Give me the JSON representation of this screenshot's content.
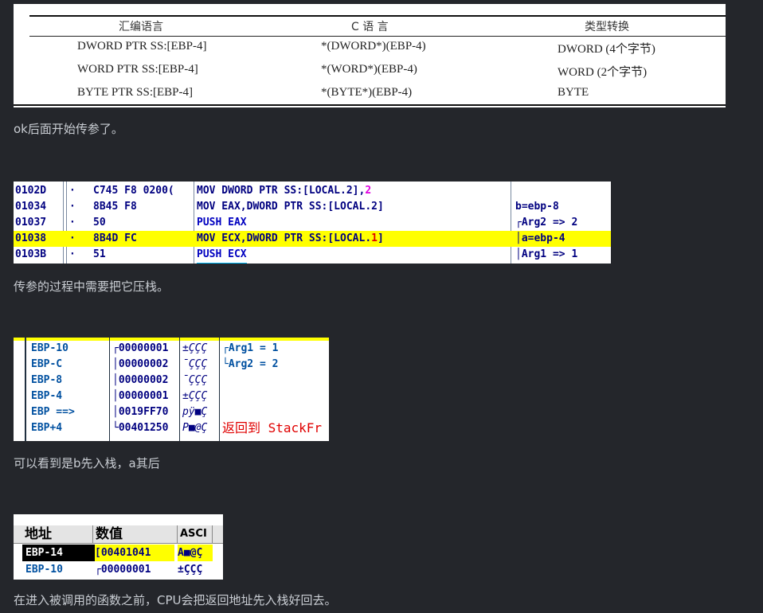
{
  "table": {
    "headers": [
      "汇编语言",
      "C 语 言",
      "类型转换"
    ],
    "rows": [
      [
        "DWORD PTR SS:[EBP-4]",
        "*(DWORD*)(EBP-4)",
        "DWORD (4个字节)"
      ],
      [
        "WORD PTR SS:[EBP-4]",
        "*(WORD*)(EBP-4)",
        "WORD (2个字节)"
      ],
      [
        "BYTE PTR SS:[EBP-4]",
        "*(BYTE*)(EBP-4)",
        "BYTE"
      ]
    ]
  },
  "paragraphs": [
    "ok后面开始传参了。",
    "传参的过程中需要把它压栈。",
    "可以看到是b先入栈，a其后",
    "在进入被调用的函数之前，CPU会把返回地址先入栈好回去。"
  ],
  "code": {
    "rows": [
      {
        "addr": "0102D",
        "dot": "·",
        "hex": "C745 F8 0200(",
        "asm_a": "MOV DWORD PTR SS:[LOCAL.2],",
        "asm_b": "2",
        "comment": ""
      },
      {
        "addr": "01034",
        "dot": "·",
        "hex": "8B45 F8",
        "asm_a": "MOV EAX,DWORD PTR SS:[LOCAL.2]",
        "asm_b": "",
        "comment": "b=ebp-8"
      },
      {
        "addr": "01037",
        "dot": "·",
        "hex": "50",
        "asm_a": "PUSH EAX",
        "asm_b": "",
        "comment": "┌Arg2 => 2"
      },
      {
        "addr": "01038",
        "dot": "·",
        "hex": "8B4D FC",
        "asm_a": "MOV ECX,DWORD PTR SS:[LOCAL.",
        "asm_b": "1",
        "asm_c": "]",
        "comment": "│a=ebp-4"
      },
      {
        "addr": "0103B",
        "dot": "·",
        "hex": "51",
        "asm_a": "PUSH ECX",
        "asm_b": "",
        "comment": "│Arg1 => 1"
      }
    ]
  },
  "stack": {
    "rows": [
      {
        "label": "EBP-10",
        "value": "┌00000001",
        "ascii": "±ÇÇÇ",
        "comment": "┌Arg1 = 1"
      },
      {
        "label": "EBP-C",
        "value": "│00000002",
        "ascii": "¯ÇÇÇ",
        "comment": "└Arg2 = 2"
      },
      {
        "label": "EBP-8",
        "value": "│00000002",
        "ascii": "¯ÇÇÇ",
        "comment": ""
      },
      {
        "label": "EBP-4",
        "value": "│00000001",
        "ascii": "±ÇÇÇ",
        "comment": ""
      },
      {
        "label": "EBP ==>",
        "value": "│0019FF70",
        "ascii": "pÿ■Ç",
        "comment": ""
      },
      {
        "label": "EBP+4",
        "value": "└00401250",
        "ascii": "P■@Ç",
        "comment": "返回到 StackFr"
      }
    ]
  },
  "dump": {
    "headers": [
      "地址",
      "数值",
      "ASCI"
    ],
    "rows": [
      {
        "label": "EBP-14",
        "value": "[00401041",
        "ascii": "A■@Ç"
      },
      {
        "label": "EBP-10",
        "value": "┌00000001",
        "ascii": "±ÇÇÇ"
      }
    ]
  }
}
